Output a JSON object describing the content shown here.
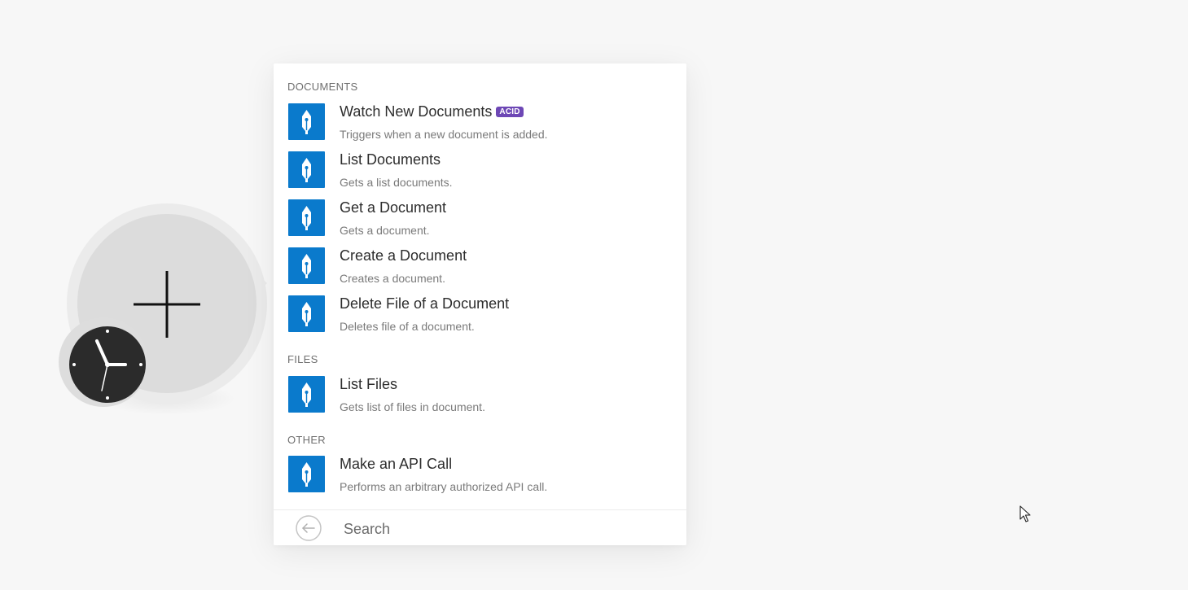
{
  "colors": {
    "app_icon_bg": "#0a7acc",
    "badge_bg": "#6d47b5",
    "background": "#f7f7f7"
  },
  "icons": {
    "module": "plus-icon",
    "trigger": "clock-icon",
    "app": "fountain-pen-nib-icon",
    "back": "arrow-left-circle-icon"
  },
  "sections": [
    {
      "title": "DOCUMENTS",
      "items": [
        {
          "title": "Watch New Documents",
          "badge": "ACID",
          "desc": "Triggers when a new document is added."
        },
        {
          "title": "List Documents",
          "desc": "Gets a list documents."
        },
        {
          "title": "Get a Document",
          "desc": "Gets a document."
        },
        {
          "title": "Create a Document",
          "desc": "Creates a document."
        },
        {
          "title": "Delete File of a Document",
          "desc": "Deletes file of a document."
        }
      ]
    },
    {
      "title": "FILES",
      "items": [
        {
          "title": "List Files",
          "desc": "Gets list of files in document."
        }
      ]
    },
    {
      "title": "OTHER",
      "items": [
        {
          "title": "Make an API Call",
          "desc": "Performs an arbitrary authorized API call."
        }
      ]
    }
  ],
  "search": {
    "placeholder": "Search"
  }
}
